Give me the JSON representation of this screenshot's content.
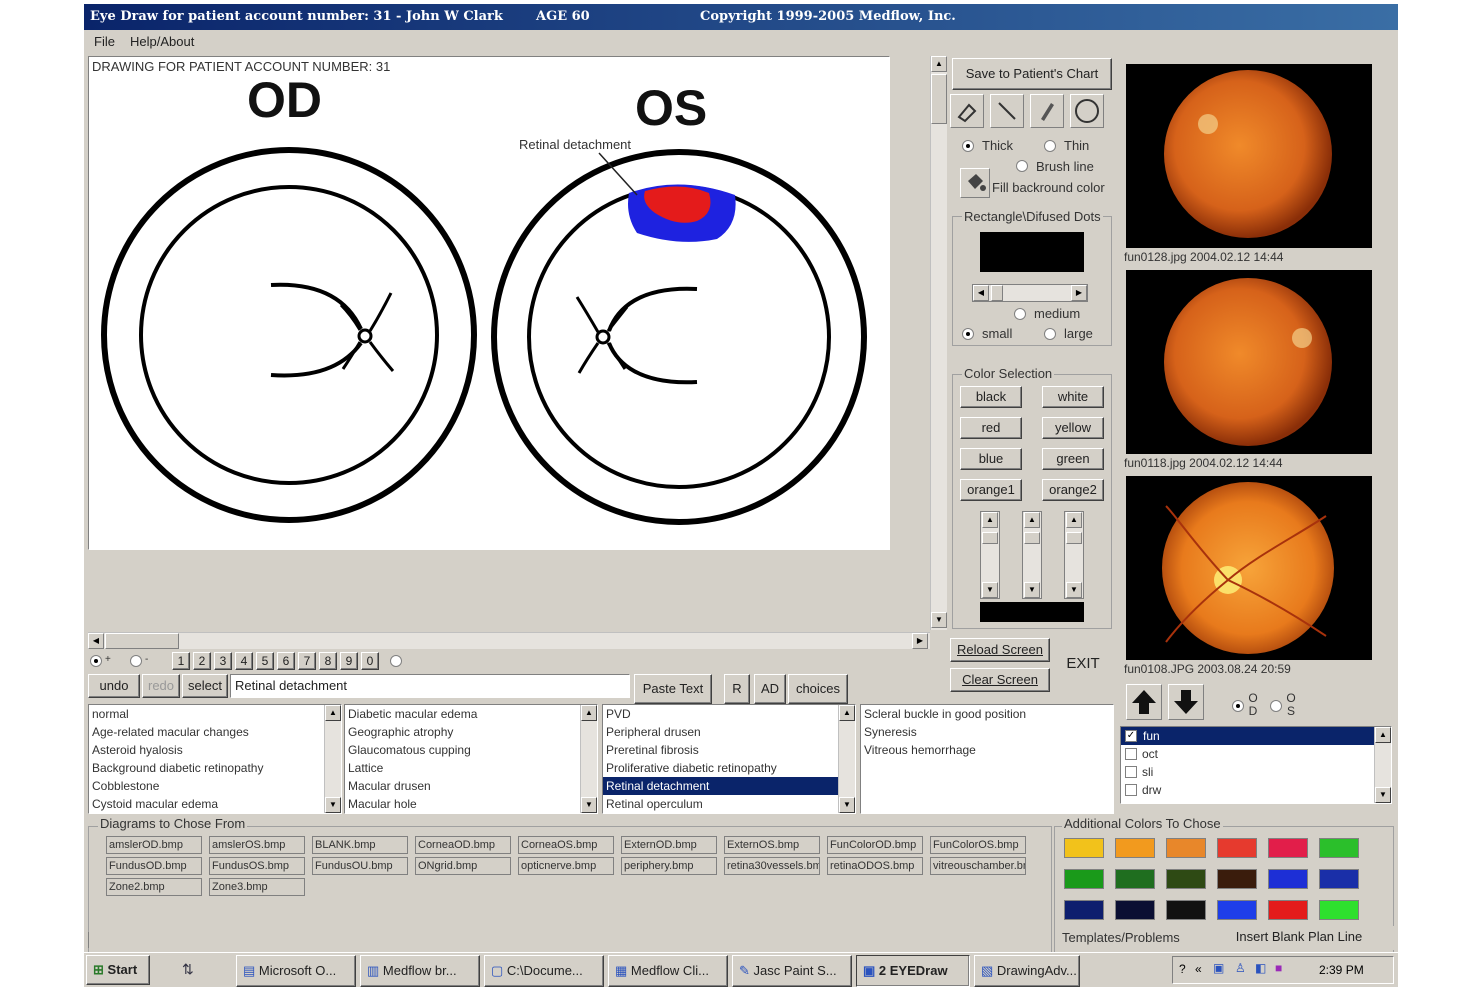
{
  "window": {
    "title": "Eye Draw  for patient account number: 31 - John W Clark",
    "age": "AGE 60",
    "copyright": "Copyright 1999-2005 Medflow, Inc."
  },
  "menu": {
    "file": "File",
    "help": "Help/About"
  },
  "canvas": {
    "header": "DRAWING FOR PATIENT ACCOUNT NUMBER: 31",
    "od_label": "OD",
    "os_label": "OS",
    "annotation": "Retinal detachment"
  },
  "tools": {
    "save": "Save to Patient's Chart",
    "thick": "Thick",
    "thin": "Thin",
    "brush": "Brush line",
    "fill": "Fill backround color",
    "rect_title": "Rectangle\\Difused Dots",
    "medium": "medium",
    "small": "small",
    "large": "large",
    "color_title": "Color Selection",
    "colors": [
      "black",
      "white",
      "red",
      "yellow",
      "blue",
      "green",
      "orange1",
      "orange2"
    ],
    "reload": "Reload Screen",
    "clear": "Clear Screen",
    "exit": "EXIT"
  },
  "number_row": [
    "1",
    "2",
    "3",
    "4",
    "5",
    "6",
    "7",
    "8",
    "9",
    "0"
  ],
  "edit": {
    "undo": "undo",
    "redo": "redo",
    "select": "select",
    "text_value": "Retinal detachment",
    "paste": "Paste Text",
    "r": "R",
    "ad": "AD",
    "choices": "choices"
  },
  "lists": {
    "list1": [
      "normal",
      "Age-related macular changes",
      "Asteroid hyalosis",
      "Background diabetic retinopathy",
      "Cobblestone",
      "Cystoid macular edema"
    ],
    "list2": [
      "Diabetic macular edema",
      "Geographic atrophy",
      "Glaucomatous cupping",
      "Lattice",
      "Macular drusen",
      "Macular hole"
    ],
    "list3": [
      "PVD",
      "Peripheral drusen",
      "Preretinal fibrosis",
      "Proliferative diabetic retinopathy",
      "Retinal detachment",
      "Retinal operculum"
    ],
    "list3_selected": "Retinal detachment",
    "list4": [
      "Scleral buckle in good position",
      "Syneresis",
      "Vitreous hemorrhage"
    ]
  },
  "diagrams": {
    "title": "Diagrams to Chose From",
    "files": [
      [
        "amslerOD.bmp",
        "amslerOS.bmp",
        "BLANK.bmp",
        "CorneaOD.bmp",
        "CorneaOS.bmp",
        "ExternOD.bmp",
        "ExternOS.bmp",
        "FunColorOD.bmp",
        "FunColorOS.bmp"
      ],
      [
        "FundusOD.bmp",
        "FundusOS.bmp",
        "FundusOU.bmp",
        "ONgrid.bmp",
        "opticnerve.bmp",
        "periphery.bmp",
        "retina30vessels.bmp",
        "retinaODOS.bmp",
        "vitreouschamber.bmp"
      ],
      [
        "Zone2.bmp",
        "Zone3.bmp"
      ]
    ]
  },
  "additional_colors": {
    "title": "Additional Colors To Chose",
    "swatches": [
      "#f2c21b",
      "#f29a1e",
      "#e8872a",
      "#e63a2e",
      "#e21e4a",
      "#2bbf2b",
      "#1a9a1a",
      "#1f6e1f",
      "#2e4a14",
      "#3a1c0c",
      "#1d2fd6",
      "#1a2fa8",
      "#0d1e6e",
      "#0a0f33",
      "#111111",
      "#1e3ee8",
      "#e41b1b",
      "#2ee02e"
    ],
    "templates": "Templates/Problems",
    "insert": "Insert Blank Plan Line"
  },
  "images": {
    "captions": [
      "fun0128.jpg  2004.02.12 14:44",
      "fun0118.jpg  2004.02.12 14:44",
      "fun0108.JPG  2003.08.24 20:59"
    ],
    "od": "O D",
    "os": "O S",
    "checks": [
      {
        "label": "fun",
        "checked": true
      },
      {
        "label": "oct",
        "checked": false
      },
      {
        "label": "sli",
        "checked": false
      },
      {
        "label": "drw",
        "checked": false
      }
    ]
  },
  "taskbar": {
    "start": "Start",
    "items": [
      "Microsoft O...",
      "Medflow br...",
      "C:\\Docume...",
      "Medflow Cli...",
      "Jasc Paint S...",
      "2 EYEDraw",
      "DrawingAdv..."
    ],
    "clock": "2:39 PM"
  }
}
